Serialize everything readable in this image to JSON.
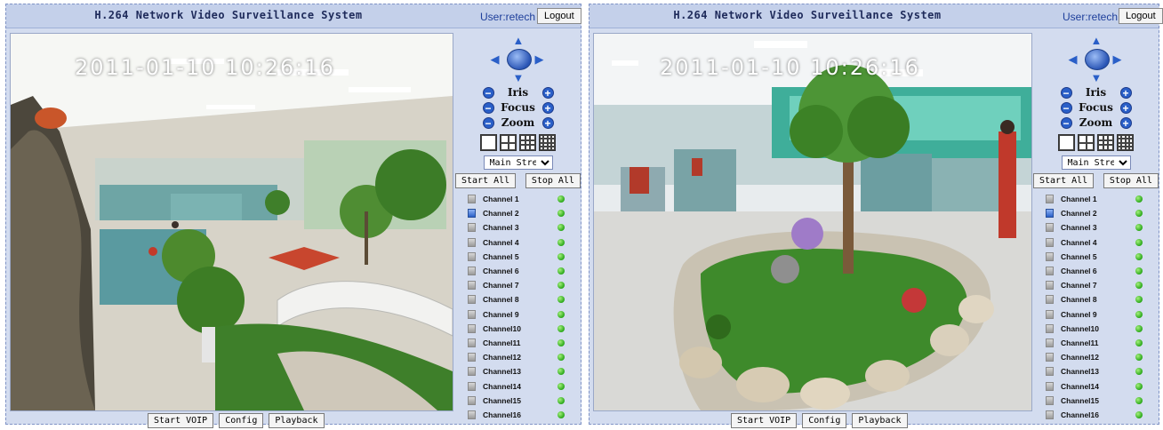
{
  "panels": [
    {
      "header": {
        "title": "H.264 Network Video Surveillance System",
        "user": "User:retech",
        "logout_label": "Logout"
      },
      "timestamp": "2011-01-10  10:26:16",
      "ptz": {
        "iris_label": "Iris",
        "focus_label": "Focus",
        "zoom_label": "Zoom"
      },
      "stream_select": {
        "selected": "Main Stream"
      },
      "start_all_label": "Start All",
      "stop_all_label": "Stop All",
      "channels": [
        "Channel 1",
        "Channel 2",
        "Channel 3",
        "Channel 4",
        "Channel 5",
        "Channel 6",
        "Channel 7",
        "Channel 8",
        "Channel 9",
        "Channel10",
        "Channel11",
        "Channel12",
        "Channel13",
        "Channel14",
        "Channel15",
        "Channel16"
      ],
      "active_channel_index": 1,
      "bottom": {
        "voip_label": "Start VOIP",
        "config_label": "Config",
        "playback_label": "Playback"
      }
    },
    {
      "header": {
        "title": "H.264 Network Video Surveillance System",
        "user": "User:retech",
        "logout_label": "Logout"
      },
      "timestamp": "2011-01-10  10:26:16",
      "ptz": {
        "iris_label": "Iris",
        "focus_label": "Focus",
        "zoom_label": "Zoom"
      },
      "stream_select": {
        "selected": "Main Stream"
      },
      "start_all_label": "Start All",
      "stop_all_label": "Stop All",
      "channels": [
        "Channel 1",
        "Channel 2",
        "Channel 3",
        "Channel 4",
        "Channel 5",
        "Channel 6",
        "Channel 7",
        "Channel 8",
        "Channel 9",
        "Channel10",
        "Channel11",
        "Channel12",
        "Channel13",
        "Channel14",
        "Channel15",
        "Channel16"
      ],
      "active_channel_index": 1,
      "bottom": {
        "voip_label": "Start VOIP",
        "config_label": "Config",
        "playback_label": "Playback"
      }
    }
  ],
  "colors": {
    "panel_bg": "#d3dcef",
    "header_bg": "#c4d0ea",
    "accent_blue": "#2a5fc8",
    "status_green": "#2aa81a"
  }
}
